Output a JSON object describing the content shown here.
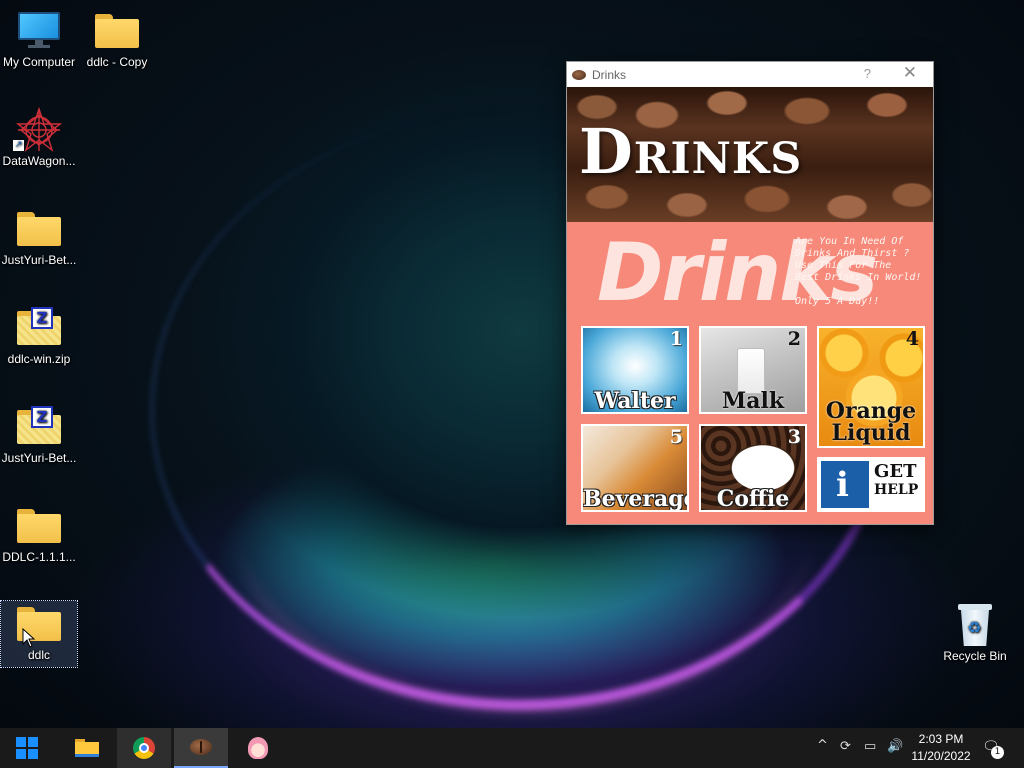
{
  "desktop": {
    "icons": [
      {
        "label": "My Computer",
        "icon": "monitor-icon"
      },
      {
        "label": "ddlc - Copy",
        "icon": "folder-icon"
      },
      {
        "label": "DataWagon...",
        "icon": "star-app-icon"
      },
      {
        "label": "JustYuri-Bet...",
        "icon": "folder-icon"
      },
      {
        "label": "ddlc-win.zip",
        "icon": "zip-folder-icon"
      },
      {
        "label": "JustYuri-Bet...",
        "icon": "zip-folder-icon"
      },
      {
        "label": "DDLC-1.1.1...",
        "icon": "folder-icon"
      },
      {
        "label": "ddlc",
        "icon": "folder-icon",
        "selected": true
      },
      {
        "label": "Recycle Bin",
        "icon": "recycle-bin-icon"
      }
    ]
  },
  "window": {
    "title": "Drinks",
    "help_glyph": "?",
    "close_glyph": "✕",
    "banner_title": "Drinks",
    "promo": {
      "big_text": "Drinks",
      "lines": [
        "Are You In Need Of",
        "Drinks And Thirst ?",
        "Use This For The",
        "Best Drinks In World!"
      ],
      "price": "Only 5 A Day!!"
    },
    "tiles": [
      {
        "id": "walter",
        "number": "1",
        "name": "Walter"
      },
      {
        "id": "malk",
        "number": "2",
        "name": "Malk"
      },
      {
        "id": "orange",
        "number": "4",
        "name_line1": "Orange",
        "name_line2": "Liquid"
      },
      {
        "id": "beverage",
        "number": "5",
        "name": "Beverage"
      },
      {
        "id": "coffee",
        "number": "3",
        "name": "Coffie"
      },
      {
        "id": "help",
        "glyph": "i",
        "line1": "GET",
        "line2": "HELP"
      }
    ]
  },
  "taskbar": {
    "apps": [
      {
        "name": "start",
        "icon": "windows-logo-icon"
      },
      {
        "name": "file-explorer",
        "icon": "folder-icon"
      },
      {
        "name": "chrome",
        "icon": "chrome-icon",
        "state": "open"
      },
      {
        "name": "drinks",
        "icon": "coffee-bean-icon",
        "state": "active"
      },
      {
        "name": "anime-app",
        "icon": "anime-character-icon"
      }
    ],
    "tray": {
      "chevron": "^",
      "time": "2:03 PM",
      "date": "11/20/2022",
      "notification_count": "1"
    }
  },
  "colors": {
    "window_bg": "#f7897a",
    "taskbar_bg": "#1a1a1a",
    "accent": "#1a8fff"
  }
}
